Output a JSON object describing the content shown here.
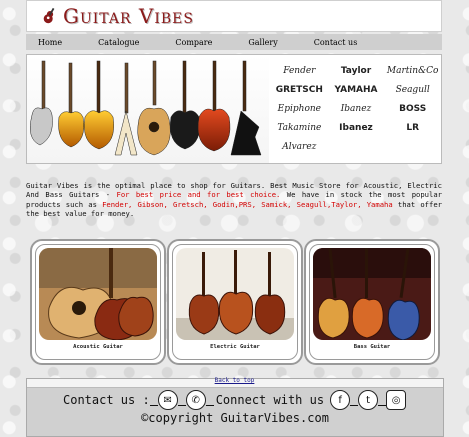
{
  "site": {
    "title": "Guitar Vibes"
  },
  "nav": [
    "Home",
    "Catalogue",
    "Compare",
    "Gallery",
    "Contact us"
  ],
  "banner": {
    "brands": [
      "Fender",
      "Taylor",
      "Martin&Co",
      "GRETSCH",
      "YAMAHA",
      "Seagull",
      "Epiphone",
      "Ibanez",
      "BOSS",
      "Takamine",
      "Ibanez",
      "LR",
      "Alvarez"
    ]
  },
  "description": {
    "part1": "Guitar Vibes is the optimal place to shop for Guitars. Best Music Store for Acoustic, Electric And Bass Guitars - ",
    "highlight1": "For best price and for best choice.",
    "part2": " We have in stock the most popular products such as ",
    "highlight2": "Fender, Gibson, Gretsch, Godin,PRS, Samick, Seagull,Taylor, Yamaha",
    "part3": " that offer the best value for money."
  },
  "cards": [
    {
      "label": "Acoustic Guitar"
    },
    {
      "label": "Electric Guitar"
    },
    {
      "label": "Bass Guitar"
    }
  ],
  "footer": {
    "back_to_top": "Back to top",
    "contact_label": "Contact us :",
    "connect_label": "Connect with us",
    "copyright": "©copyright GuitarVibes.com"
  },
  "colors": {
    "brand": "#8b1a1a",
    "highlight": "#d40000",
    "nav_bg": "#cfcfcf",
    "footer_bg": "#d0d0d0"
  }
}
